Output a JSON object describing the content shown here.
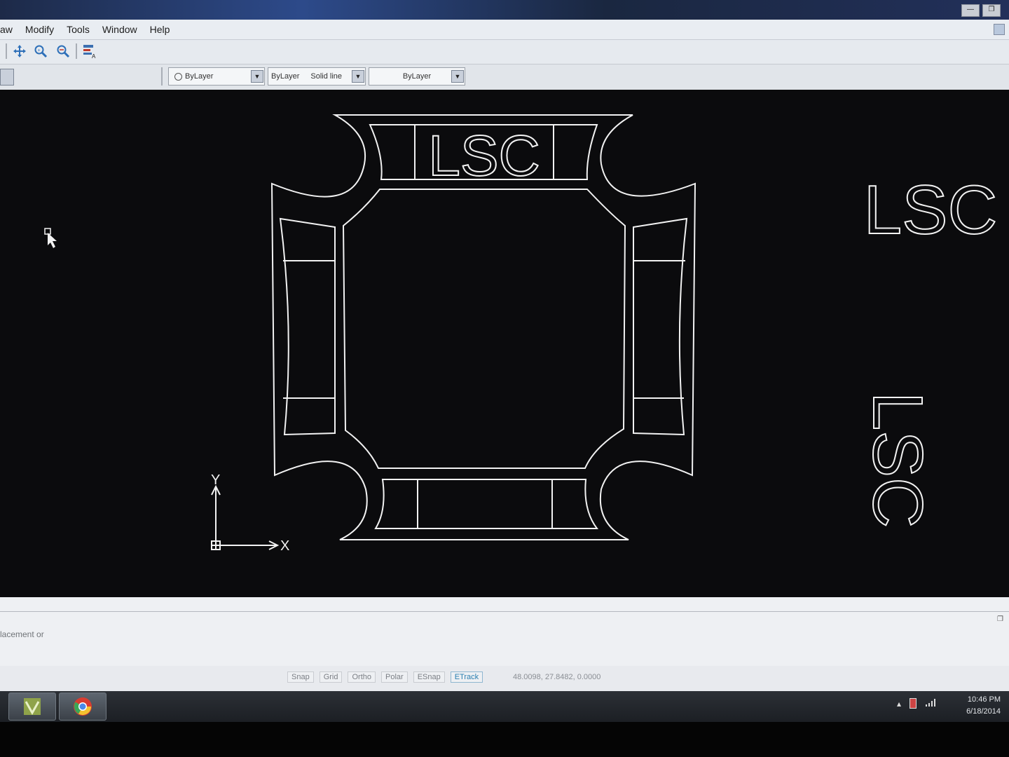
{
  "menu": {
    "items": [
      "aw",
      "Modify",
      "Tools",
      "Window",
      "Help"
    ]
  },
  "toolbar": {
    "icons": [
      "pan-icon",
      "zoom-realtime-icon",
      "zoom-previous-icon",
      "properties-icon"
    ]
  },
  "properties_bar": {
    "color_combo": "ByLayer",
    "linetype_combo": "ByLayer",
    "linetype_name": "Solid line",
    "lineweight_combo": "ByLayer"
  },
  "drawing": {
    "main_text": "LSC",
    "side_text": "LSC",
    "vertical_text": "LSC",
    "ucs_x_label": "X",
    "ucs_y_label": "Y"
  },
  "command": {
    "line_text": "lacement or"
  },
  "status": {
    "toggles": [
      {
        "label": "Snap",
        "on": false
      },
      {
        "label": "Grid",
        "on": false
      },
      {
        "label": "Ortho",
        "on": false
      },
      {
        "label": "Polar",
        "on": false
      },
      {
        "label": "ESnap",
        "on": false
      },
      {
        "label": "ETrack",
        "on": true
      }
    ],
    "coordinates": "48.0098, 27.8482, 0.0000"
  },
  "taskbar": {
    "time": "10:46 PM",
    "date": "6/18/2014"
  },
  "colors": {
    "canvas_bg": "#0b0b0d",
    "drawing_lines": "#f2f2f2",
    "etrack_on": "#2a7fb0"
  }
}
